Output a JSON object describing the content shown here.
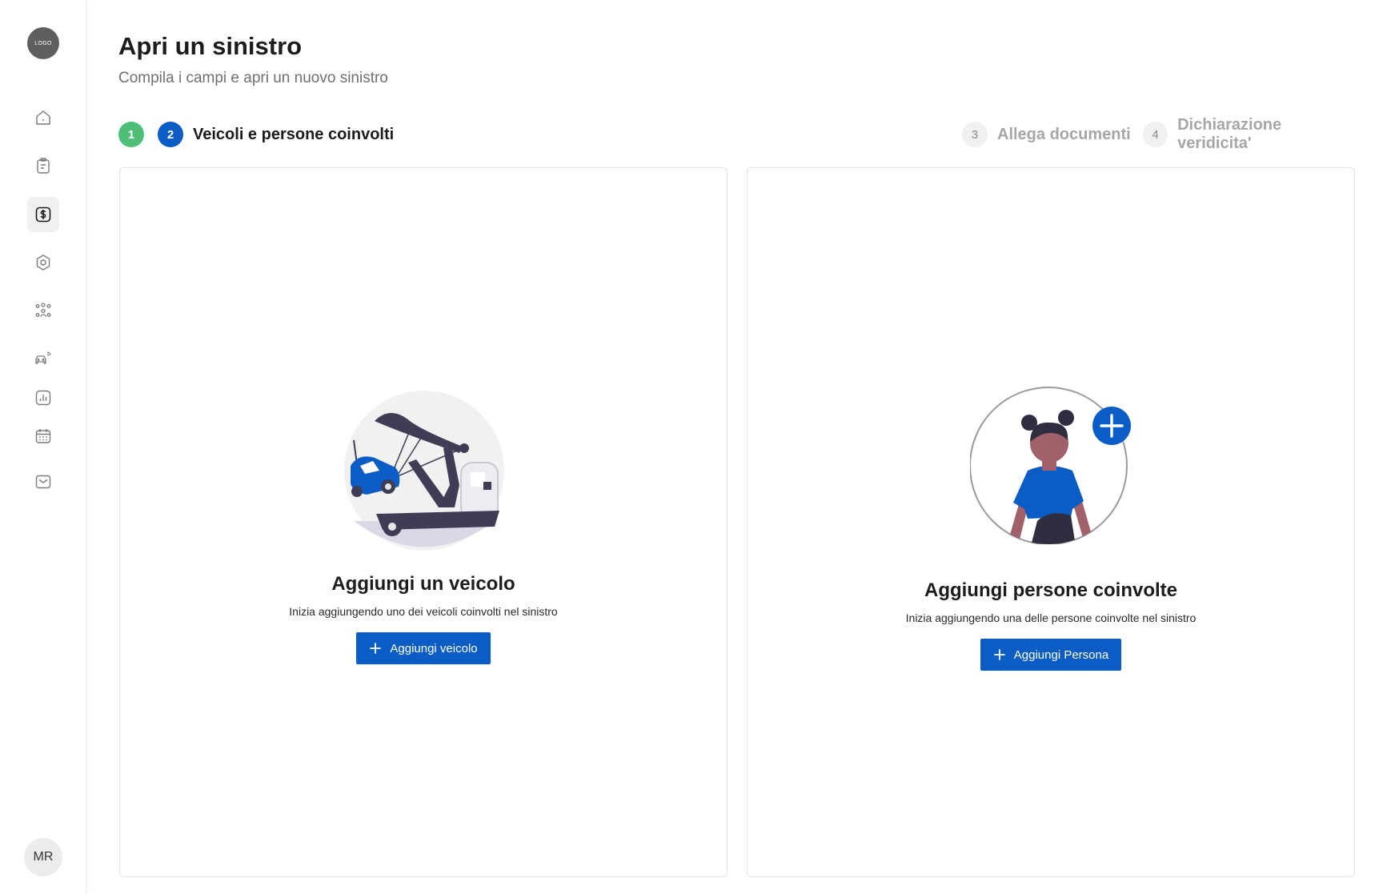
{
  "sidebar": {
    "logo_text": "LOGO",
    "items": [
      {
        "icon": "home-icon"
      },
      {
        "icon": "clipboard-icon"
      },
      {
        "icon": "dollar-icon",
        "active": true
      },
      {
        "icon": "hexagon-settings-icon"
      },
      {
        "icon": "group-icon"
      },
      {
        "icon": "connected-car-icon"
      },
      {
        "icon": "bar-chart-icon"
      },
      {
        "icon": "calendar-icon"
      },
      {
        "icon": "inbox-icon"
      }
    ],
    "user_initials": "MR"
  },
  "header": {
    "title": "Apri un sinistro",
    "subtitle": "Compila i campi e apri un nuovo sinistro"
  },
  "stepper": {
    "steps": [
      {
        "number": "1",
        "label": "",
        "status": "done"
      },
      {
        "number": "2",
        "label": "Veicoli e persone coinvolti",
        "status": "current"
      },
      {
        "number": "3",
        "label": "Allega documenti",
        "status": "todo"
      },
      {
        "number": "4",
        "label": "Dichiarazione veridicita'",
        "status": "todo"
      }
    ]
  },
  "vehicle_card": {
    "title": "Aggiungi un veicolo",
    "description": "Inizia aggiungendo uno dei veicoli coinvolti nel sinistro",
    "button_label": "Aggiungi veicolo"
  },
  "person_card": {
    "title": "Aggiungi persone coinvolte",
    "description": "Inizia aggiungendo una delle persone coinvolte nel sinistro",
    "button_label": "Aggiungi Persona"
  },
  "colors": {
    "primary": "#0b5cc4",
    "success": "#4fbf78",
    "muted_text": "#a6a6a6"
  }
}
